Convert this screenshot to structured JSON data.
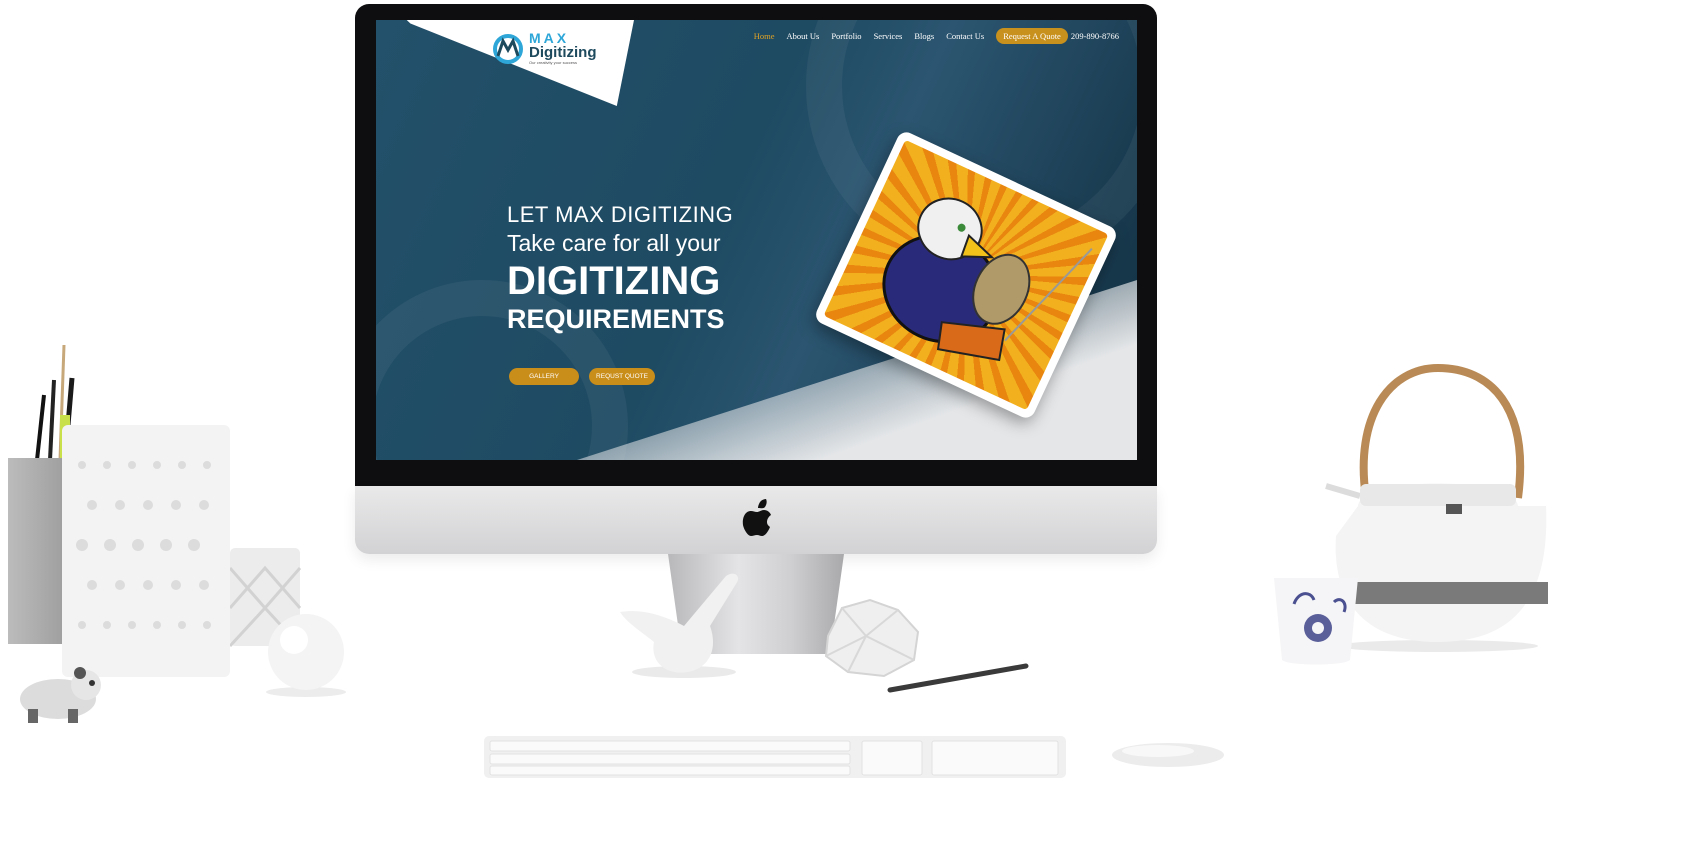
{
  "site": {
    "logo": {
      "wordmark_top": "MAX",
      "wordmark_bottom": "Digitizing",
      "tagline": "Our creativity your success"
    },
    "nav": {
      "items": [
        {
          "label": "Home",
          "active": true
        },
        {
          "label": "About Us",
          "active": false
        },
        {
          "label": "Portfolio",
          "active": false
        },
        {
          "label": "Services",
          "active": false
        },
        {
          "label": "Blogs",
          "active": false
        },
        {
          "label": "Contact Us",
          "active": false
        }
      ],
      "quote_button": "Request A Quote",
      "phone": "209-890-8766"
    },
    "hero": {
      "line1": "LET MAX DIGITIZING",
      "line2": "Take care for all your",
      "line3": "DIGITIZING",
      "line4": "REQUIREMENTS",
      "button_gallery": "GALLERY",
      "button_quote": "REQUST QUOTE"
    }
  },
  "colors": {
    "accent_gold": "#c98d1a",
    "active_nav": "#e0a326",
    "hero_blue": "#1e4a62",
    "logo_cyan": "#2ea7d8"
  },
  "icons": [
    "apple-logo-icon",
    "max-logo-icon"
  ]
}
